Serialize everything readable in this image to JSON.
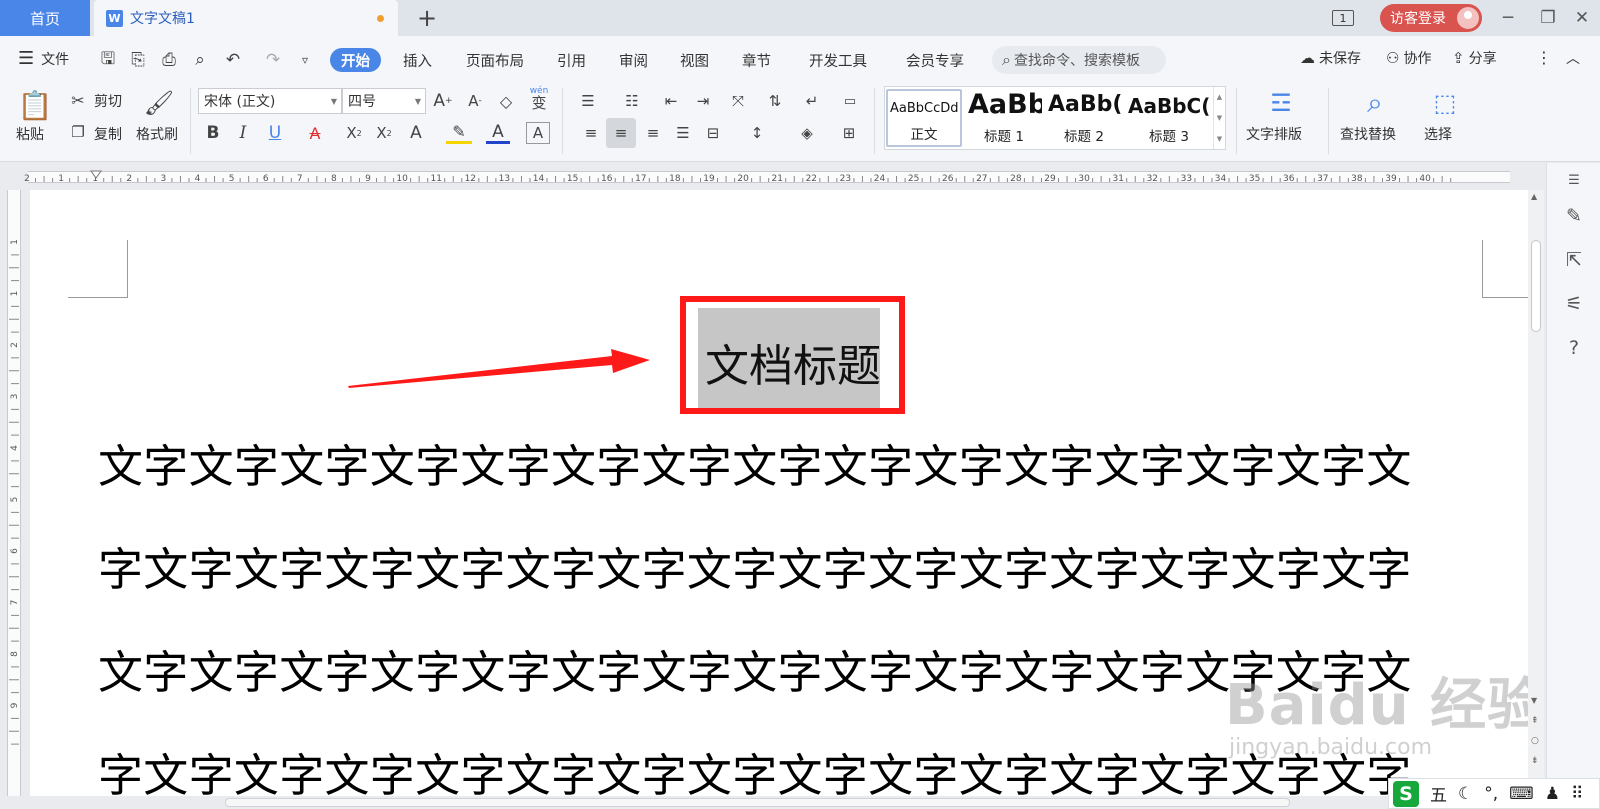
{
  "titlebar": {
    "home_tab": "首页",
    "doc_tab": "文字文稿1",
    "doc_badge": "W",
    "new_tab": "+",
    "page_count": "1",
    "login": "访客登录"
  },
  "menubar": {
    "file": "文件",
    "tabs": [
      "开始",
      "插入",
      "页面布局",
      "引用",
      "审阅",
      "视图",
      "章节",
      "开发工具",
      "会员专享"
    ],
    "search_placeholder": "查找命令、搜索模板",
    "unsaved": "未保存",
    "collaborate": "协作",
    "share": "分享"
  },
  "ribbon": {
    "paste": "粘贴",
    "cut": "剪切",
    "copy": "复制",
    "format_painter": "格式刷",
    "font_name": "宋体 (正文)",
    "font_size": "四号",
    "phonetic": "wén",
    "styles": [
      {
        "preview": "AaBbCcDd",
        "name": "正文"
      },
      {
        "preview": "AaBb",
        "name": "标题 1"
      },
      {
        "preview": "AaBb(",
        "name": "标题 2"
      },
      {
        "preview": "AaBbC(",
        "name": "标题 3"
      }
    ],
    "text_layout": "文字排版",
    "find_replace": "查找替换",
    "select": "选择"
  },
  "ruler": {
    "h_labels": [
      "2",
      "1",
      "1",
      "2",
      "3",
      "4",
      "5",
      "6",
      "7",
      "8",
      "9",
      "10",
      "11",
      "12",
      "13",
      "14",
      "15",
      "16",
      "17",
      "18",
      "19",
      "20",
      "21",
      "22",
      "23",
      "24",
      "25",
      "26",
      "27",
      "28",
      "29",
      "30",
      "31",
      "32",
      "33",
      "34",
      "35",
      "36",
      "37",
      "38",
      "39",
      "40"
    ],
    "v_labels": [
      "1",
      "1",
      "2",
      "3",
      "4",
      "5",
      "6",
      "7",
      "8",
      "9"
    ]
  },
  "document": {
    "title": "文档标题",
    "lines": [
      "文字文字文字文字文字文字文字文字文字文字文字文字文字文字文",
      "字文字文字文字文字文字文字文字文字文字文字文字文字文字文字",
      "文字文字文字文字文字文字文字文字文字文字文字文字文字文字文",
      "字文字文字文字文字文字文字文字文字文字文字文字文字文字文字"
    ]
  },
  "watermark": {
    "brand": "Baidu 经验",
    "url": "jingyan.baidu.com"
  },
  "ime": {
    "logo": "S",
    "mode": "五"
  },
  "colors": {
    "accent": "#4a86e8",
    "annotation_red": "#ff1a1a",
    "selection_gray": "#c6c6c6",
    "login_red": "#d9534f"
  }
}
